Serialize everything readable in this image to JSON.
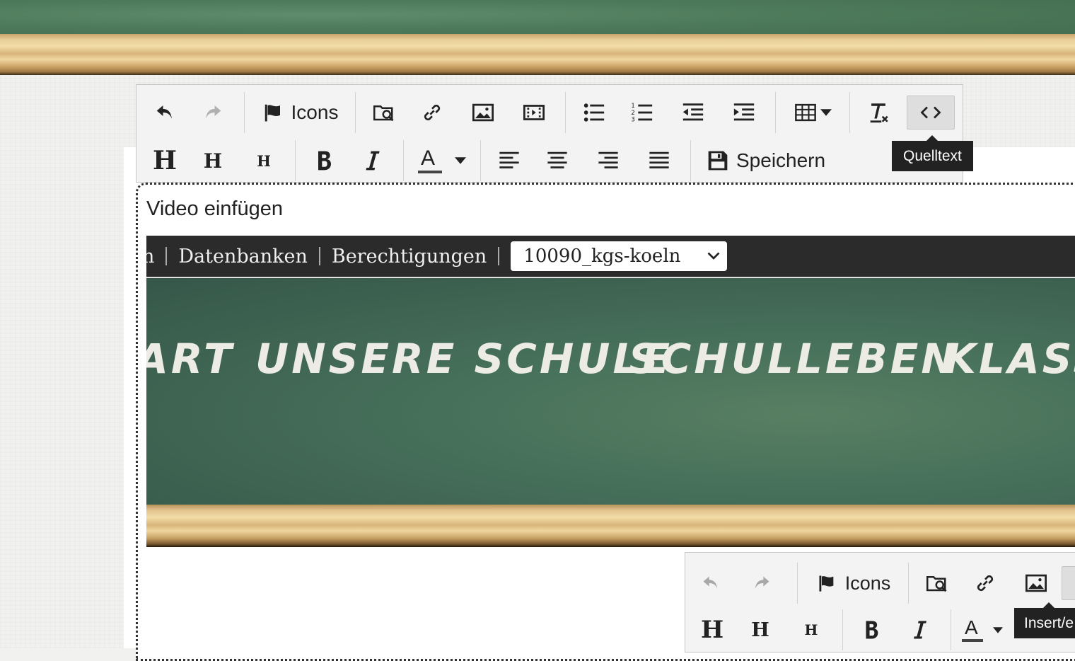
{
  "toolbar": {
    "icons_label": "Icons",
    "save_label": "Speichern",
    "font_color_glyph": "A",
    "tooltip": "Quelltext",
    "heading_glyph": "H"
  },
  "dialog": {
    "title": "Video einfügen",
    "admin_bar": {
      "partial_item": "n",
      "items": [
        "Datenbanken",
        "Berechtigungen"
      ],
      "selected_db": "10090_kgs-koeln"
    },
    "site_nav": [
      "ART",
      "UNSERE SCHULE",
      "SCHULLEBEN",
      "KLASS"
    ],
    "inner_toolbar": {
      "icons_label": "Icons",
      "font_color_glyph": "A",
      "tooltip": "Insert/e"
    }
  }
}
